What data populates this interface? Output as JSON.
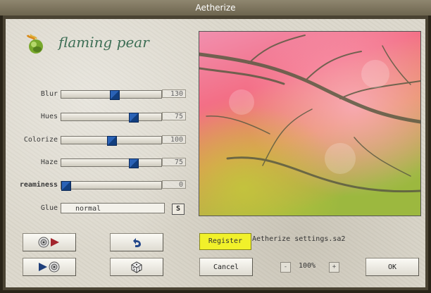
{
  "window": {
    "title": "Aetherize"
  },
  "logo": {
    "text": "flaming pear"
  },
  "sliders": [
    {
      "label": "Blur",
      "value_text": "130",
      "level": 0.53
    },
    {
      "label": "Hues",
      "value_text": "75",
      "level": 0.74
    },
    {
      "label": "Colorize",
      "value_text": "100",
      "level": 0.5
    },
    {
      "label": "Haze",
      "value_text": "75",
      "level": 0.74
    },
    {
      "label": "reaminess",
      "value_text": "0",
      "level": 0.0
    }
  ],
  "glue": {
    "label": "Glue",
    "value": "normal",
    "s_button": "S"
  },
  "buttons": {
    "register": "Register",
    "cancel": "Cancel",
    "ok": "OK"
  },
  "settings_file": "Aetherize settings.sa2",
  "zoom": {
    "level": "100%",
    "minus": "-",
    "plus": "+"
  },
  "icons": {
    "save_preset": "disc-arrow-right-icon",
    "load_preset": "arrow-right-disc-icon",
    "undo": "undo-arrow-icon",
    "randomize": "dice-icon",
    "logo": "pear-flame-icon"
  },
  "colors": {
    "register_bg": "#f1f12a",
    "slider_thumb": "#1e4f9c",
    "logo_text": "#3d6e55"
  }
}
